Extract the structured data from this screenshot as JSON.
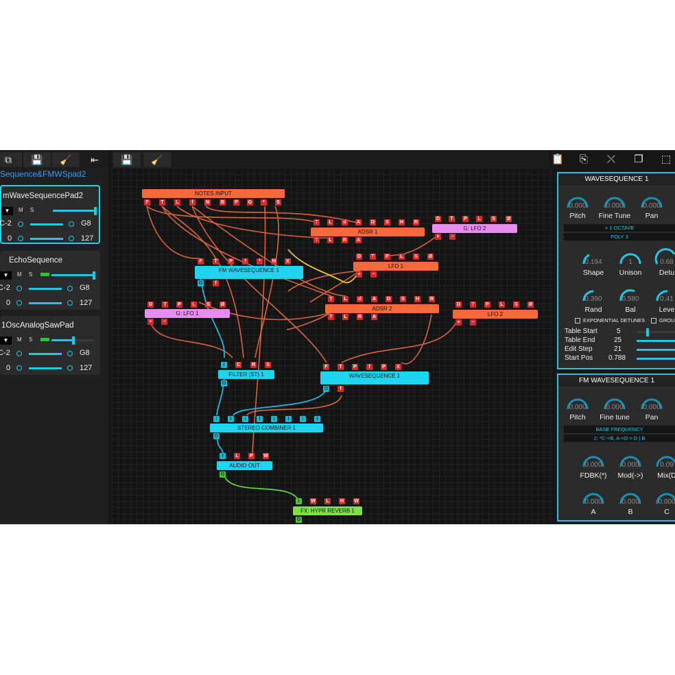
{
  "toolbar": {
    "left_icons": [
      "window-copy-icon",
      "save-icon",
      "broom-icon",
      "collapse-left-icon"
    ],
    "mid_icons": [
      "save-icon",
      "broom-icon"
    ],
    "right_icons": [
      "clipboard-icon",
      "copy-file-icon",
      "close-external-icon",
      "duplicate-icon",
      "select-all-icon"
    ]
  },
  "sidebar": {
    "breadcrumb": "Sequence&FMWSpad2",
    "tracks": [
      {
        "name": "mWaveSequencePad2",
        "m": "M",
        "s": "S",
        "range_low": "C-2",
        "range_high": "G8",
        "vel_low": "0",
        "vel_high": "127",
        "level": 0.95
      },
      {
        "name": "EchoSequence",
        "m": "M",
        "s": "S",
        "range_low": "C-2",
        "range_high": "G8",
        "vel_low": "0",
        "vel_high": "127",
        "level": 0.95
      },
      {
        "name": "1OscAnalogSawPad",
        "m": "M",
        "s": "S",
        "range_low": "C-2",
        "range_high": "G8",
        "vel_low": "0",
        "vel_high": "127",
        "level": 0.45
      }
    ]
  },
  "graph": {
    "notes_input": {
      "title": "NOTES INPUT",
      "ports": [
        "F",
        "T",
        "L",
        "f",
        "N",
        "B",
        "P",
        "G",
        "*",
        "S"
      ]
    },
    "adsr1": {
      "title": "ADSR 1",
      "top": [
        "T",
        "L",
        "d",
        "A",
        "D",
        "S",
        "H",
        "R"
      ],
      "bottom": [
        "T",
        "L",
        "R",
        "A"
      ]
    },
    "glfo2": {
      "title": "G: LFO 2",
      "top": [
        "D",
        "T",
        "P",
        "L",
        "S",
        "Ø"
      ],
      "bottom": [
        "+",
        "−"
      ]
    },
    "lfo1": {
      "title": "LFO 1",
      "top": [
        "D",
        "T",
        "P",
        "L",
        "S",
        "Ø"
      ],
      "bottom": [
        "+",
        "−"
      ]
    },
    "fmws1": {
      "title": "FM WAVESEQUENCE 1",
      "top": [
        "F",
        "T",
        "P",
        "f",
        "*",
        "M",
        "X"
      ],
      "bottom": [
        "O",
        "f"
      ]
    },
    "adsr2": {
      "title": "ADSR 2",
      "top": [
        "T",
        "L",
        "d",
        "A",
        "D",
        "S",
        "H",
        "R"
      ],
      "bottom": [
        "T",
        "L",
        "R",
        "A"
      ]
    },
    "glfo1": {
      "title": "G: LFO 1",
      "top": [
        "D",
        "T",
        "P",
        "L",
        "S",
        "Ø"
      ],
      "bottom": [
        "+",
        "−"
      ]
    },
    "lfo2": {
      "title": "LFO 2",
      "top": [
        "D",
        "T",
        "P",
        "L",
        "S",
        "Ø"
      ],
      "bottom": [
        "+",
        "−"
      ]
    },
    "filter": {
      "title": "FILTER (ST) 1",
      "top": [
        "I",
        "C",
        "R",
        "S"
      ],
      "bottom": [
        "O"
      ]
    },
    "ws1": {
      "title": "WAVESEQUENCE 1",
      "top": [
        "F",
        "T",
        "P",
        "f",
        "P",
        "X"
      ],
      "bottom": [
        "O",
        "f"
      ]
    },
    "combiner": {
      "title": "STEREO COMBINER 1",
      "top": [
        "I",
        "I",
        "I",
        "I",
        "I",
        "I",
        "I",
        "I"
      ],
      "bottom": [
        "O"
      ]
    },
    "audio_out": {
      "title": "AUDIO OUT",
      "top": [
        "I",
        "L",
        "P",
        "W"
      ],
      "bottom": [
        "O"
      ]
    },
    "reverb": {
      "title": "FX: HYPR REVERB 1",
      "top": [
        "I",
        "W",
        "L",
        "H",
        "W"
      ],
      "bottom": [
        "O"
      ]
    }
  },
  "panel1": {
    "title": "WAVESEQUENCE 1",
    "knobs_row1": [
      {
        "value": "0.000",
        "label": "Pitch"
      },
      {
        "value": "0.000",
        "label": "Fine Tune"
      },
      {
        "value": "0.000",
        "label": "Pan"
      }
    ],
    "bar1": "+ 1 OCTAVE",
    "bar2": "POLY 3",
    "knobs_row2": [
      {
        "value": "0.194",
        "label": "Shape"
      },
      {
        "value": "1",
        "label": "Unison"
      },
      {
        "value": "0.68",
        "label": "Detu"
      }
    ],
    "knobs_row3": [
      {
        "value": "0.390",
        "label": "Rand"
      },
      {
        "value": "0.580",
        "label": "Bal"
      },
      {
        "value": "0.41",
        "label": "Leve"
      }
    ],
    "check1": "EXPONENTIAL DETUNES",
    "check2": "GROU",
    "params": [
      {
        "label": "Table Start",
        "value": "5",
        "level": 0.05
      },
      {
        "label": "Table End",
        "value": "25",
        "level": 1.0
      },
      {
        "label": "Edit Step",
        "value": "21",
        "level": 1.0
      },
      {
        "label": "Start Pos",
        "value": "0.788",
        "level": 1.0
      }
    ]
  },
  "panel2": {
    "title": "FM WAVESEQUENCE 1",
    "knobs_row1": [
      {
        "value": "0.000",
        "label": "Pitch"
      },
      {
        "value": "0.000",
        "label": "Fine tune"
      },
      {
        "value": "0.000",
        "label": "Pan"
      }
    ],
    "bar1": "BASE FREQUENCY",
    "bar2": "2: *C->B, A->D = D | B",
    "knobs_row2": [
      {
        "value": "0.000",
        "label": "FDBK(*)"
      },
      {
        "value": "0.000",
        "label": "Mod(->)"
      },
      {
        "value": "0.09",
        "label": "Mix(D"
      }
    ],
    "knobs_row3": [
      {
        "value": "0.000",
        "label": "A"
      },
      {
        "value": "0.000",
        "label": "B"
      },
      {
        "value": "0.000",
        "label": "C"
      }
    ]
  },
  "colors": {
    "accent": "#1fd4f1",
    "node_orange": "#f46a3a",
    "node_pink": "#e98cf0",
    "node_green": "#7be33c",
    "port_red": "#d92a2a"
  }
}
